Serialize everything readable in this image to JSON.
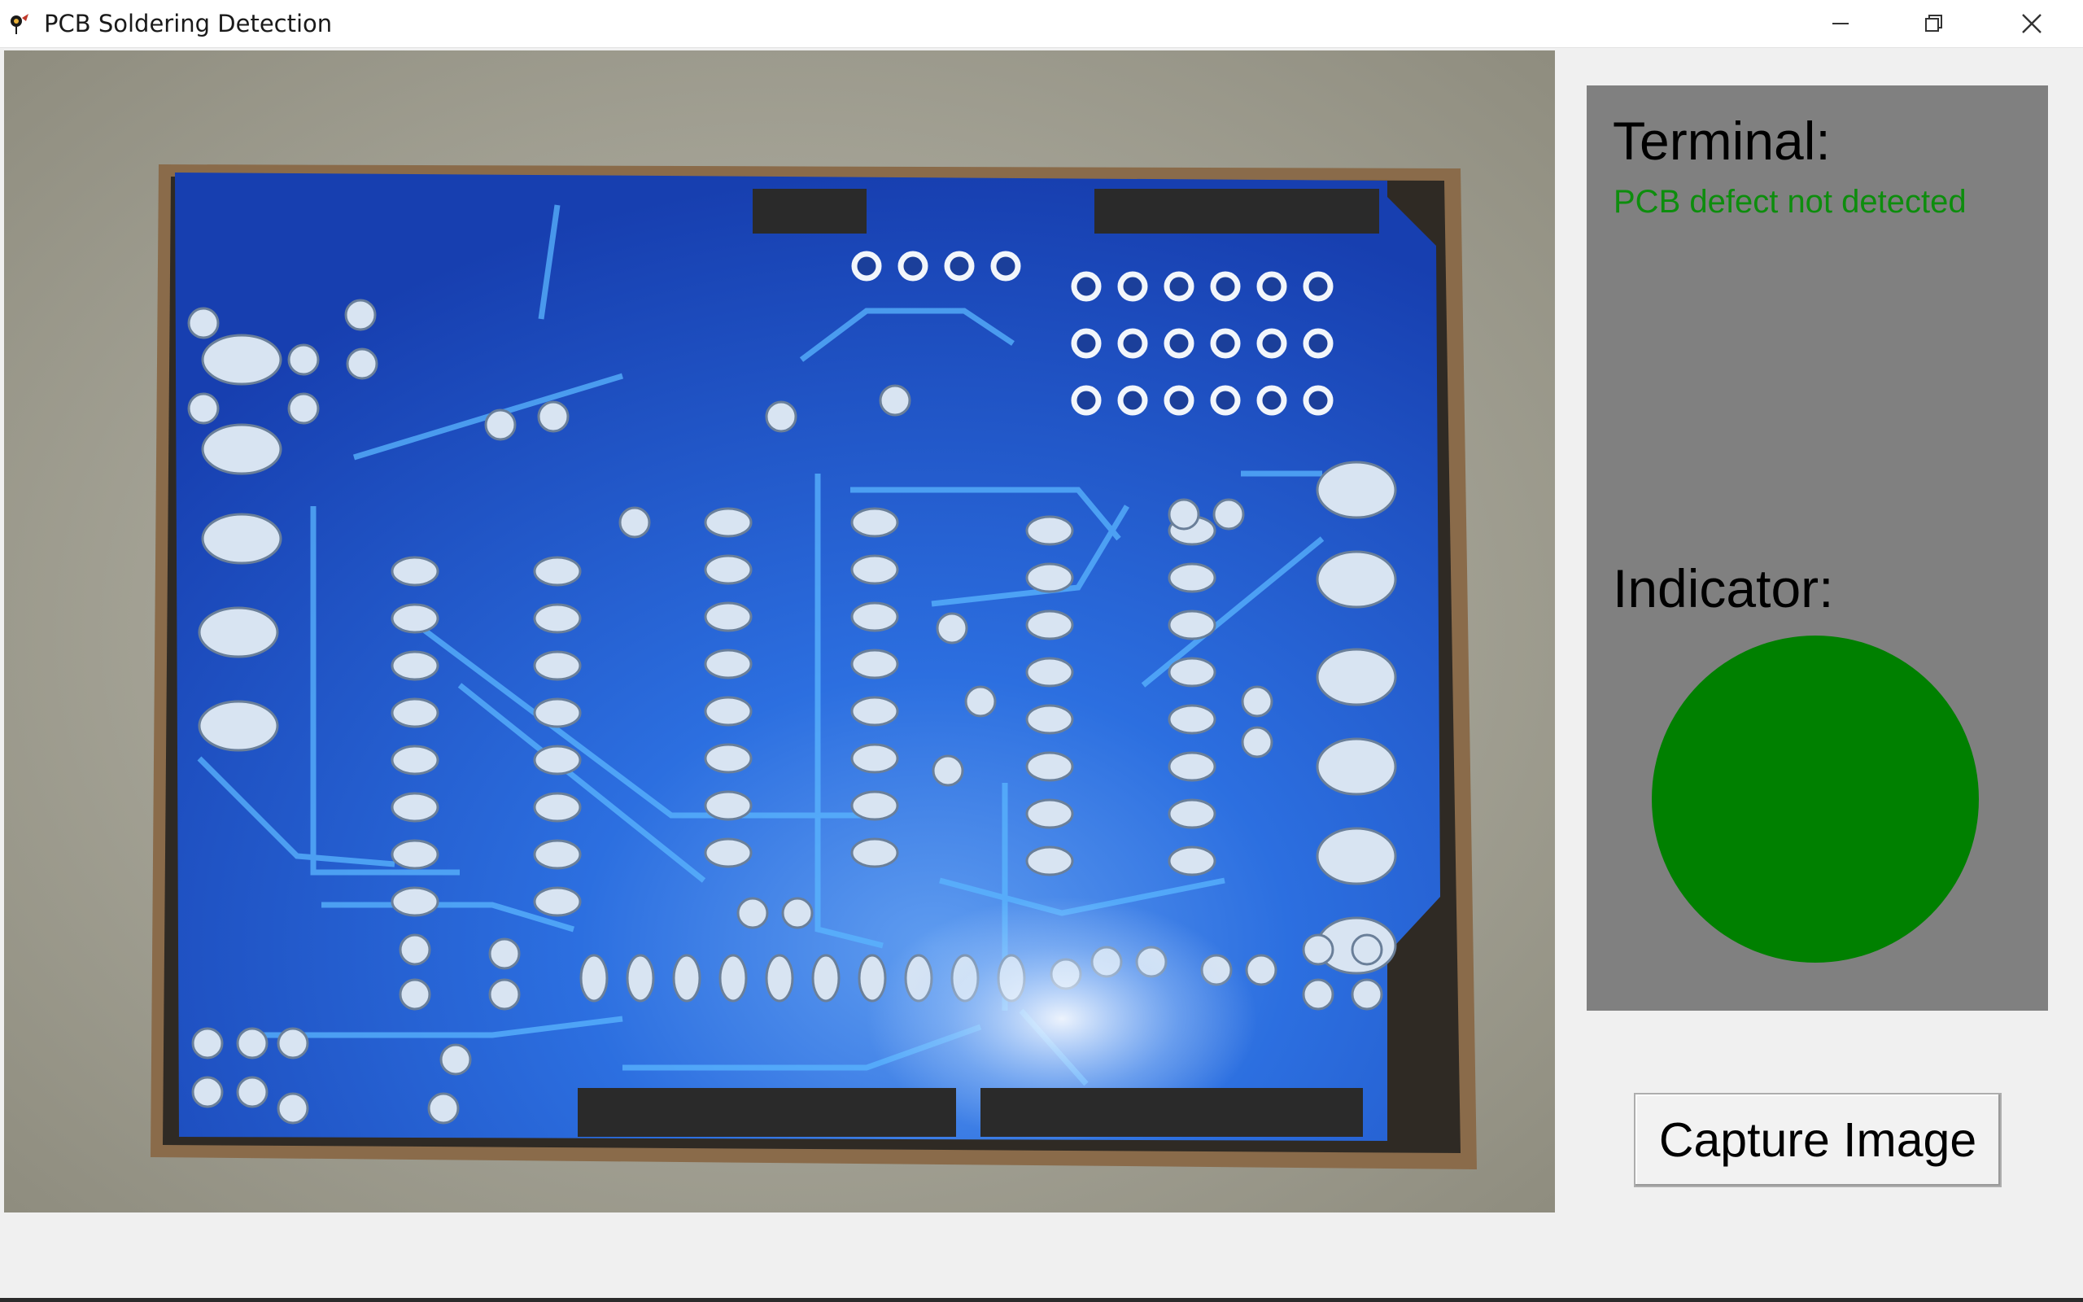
{
  "window": {
    "title": "PCB Soldering Detection",
    "app_icon": "feather-icon",
    "controls": [
      "minimize-icon",
      "restore-icon",
      "close-icon"
    ]
  },
  "feed": {
    "content": "camera-frame",
    "board_color": "#1f5fd6",
    "background_color": "#a8a697"
  },
  "panel": {
    "terminal_label": "Terminal:",
    "terminal_message": "PCB defect not detected",
    "indicator_label": "Indicator:",
    "indicator_color": "#008000",
    "background_color": "#808080"
  },
  "capture_button": {
    "label": "Capture Image"
  },
  "colors": {
    "status_ok_text": "#0d8d0d"
  }
}
